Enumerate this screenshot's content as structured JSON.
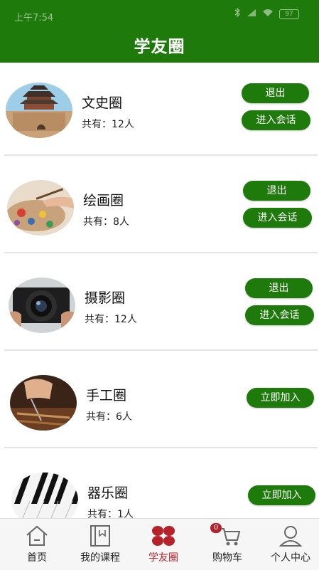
{
  "status": {
    "time": "上午7:54",
    "battery": "97"
  },
  "header": {
    "title": "学友圈"
  },
  "circles": [
    {
      "name": "文史圈",
      "count": "共有：12人",
      "image": "gate-tower-photo",
      "buttons": [
        "退出",
        "进入会话"
      ]
    },
    {
      "name": "绘画圈",
      "count": "共有：8人",
      "image": "painting-palette-photo",
      "buttons": [
        "退出",
        "进入会话"
      ]
    },
    {
      "name": "摄影圈",
      "count": "共有：12人",
      "image": "camera-lens-photo",
      "buttons": [
        "退出",
        "进入会话"
      ]
    },
    {
      "name": "手工圈",
      "count": "共有：6人",
      "image": "handcraft-photo",
      "buttons": [
        "立即加入"
      ]
    },
    {
      "name": "器乐圈",
      "count": "共有：1人",
      "image": "piano-keys-photo",
      "buttons": [
        "立即加入"
      ]
    }
  ],
  "tabbar": {
    "cart_badge": "0",
    "items": [
      {
        "label": "首页",
        "icon": "home-icon"
      },
      {
        "label": "我的课程",
        "icon": "book-icon"
      },
      {
        "label": "学友圈",
        "icon": "flower-icon",
        "active": true
      },
      {
        "label": "购物车",
        "icon": "cart-icon"
      },
      {
        "label": "个人中心",
        "icon": "user-icon"
      }
    ]
  },
  "colors": {
    "primary": "#1f7a0c",
    "active_tab": "#b6222a"
  }
}
